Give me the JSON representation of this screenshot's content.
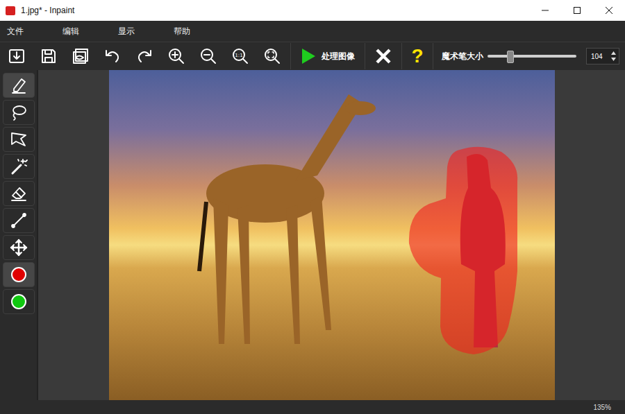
{
  "window": {
    "title": "1.jpg* - Inpaint"
  },
  "menu": [
    "文件",
    "编辑",
    "显示",
    "帮助"
  ],
  "toolbar": {
    "buttons": [
      {
        "kind": "open"
      },
      {
        "kind": "save"
      },
      {
        "kind": "preview"
      },
      {
        "kind": "undo"
      },
      {
        "kind": "redo"
      },
      {
        "kind": "zoom-in"
      },
      {
        "kind": "zoom-out"
      },
      {
        "kind": "zoom-actual",
        "label": "1:1"
      },
      {
        "kind": "zoom-fit"
      }
    ],
    "process": {
      "label": "处理图像"
    },
    "help": {
      "label": "?"
    },
    "brush": {
      "label": "魔术笔大小",
      "level": 0.22,
      "value": "104"
    }
  },
  "tools": [
    {
      "kind": "marker",
      "selected": true
    },
    {
      "kind": "lasso",
      "selected": false
    },
    {
      "kind": "polygon",
      "selected": false
    },
    {
      "kind": "wand",
      "selected": false
    },
    {
      "kind": "eraser",
      "selected": false
    },
    {
      "kind": "line",
      "selected": false
    },
    {
      "kind": "move",
      "selected": false
    },
    {
      "kind": "color",
      "color": "#e00000",
      "selected": true
    },
    {
      "kind": "color",
      "color": "#10c810",
      "selected": false
    }
  ],
  "status_bar": {
    "zoom": "135%"
  }
}
